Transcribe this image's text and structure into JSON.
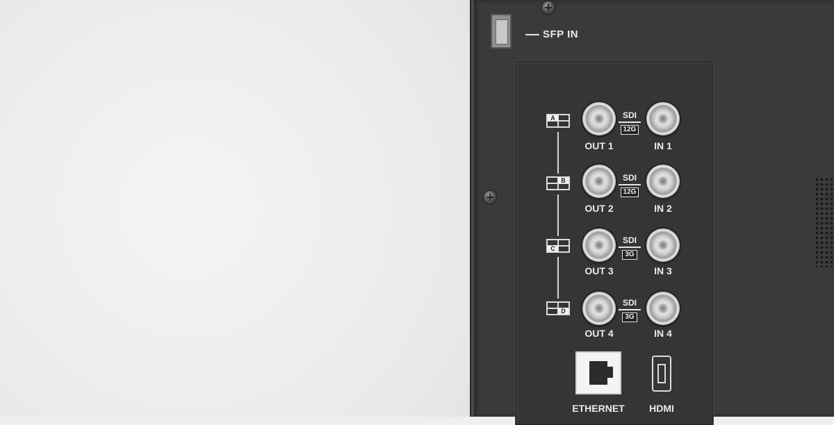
{
  "labels": {
    "sfp": "SFP IN",
    "ethernet": "ETHERNET",
    "hdmi": "HDMI"
  },
  "channels": [
    {
      "quad": "A",
      "out": "OUT 1",
      "in": "IN 1",
      "sdi": "SDI",
      "rate": "12G"
    },
    {
      "quad": "B",
      "out": "OUT 2",
      "in": "IN 2",
      "sdi": "SDI",
      "rate": "12G"
    },
    {
      "quad": "C",
      "out": "OUT 3",
      "in": "IN 3",
      "sdi": "SDI",
      "rate": "3G"
    },
    {
      "quad": "D",
      "out": "OUT 4",
      "in": "IN 4",
      "sdi": "SDI",
      "rate": "3G"
    }
  ]
}
